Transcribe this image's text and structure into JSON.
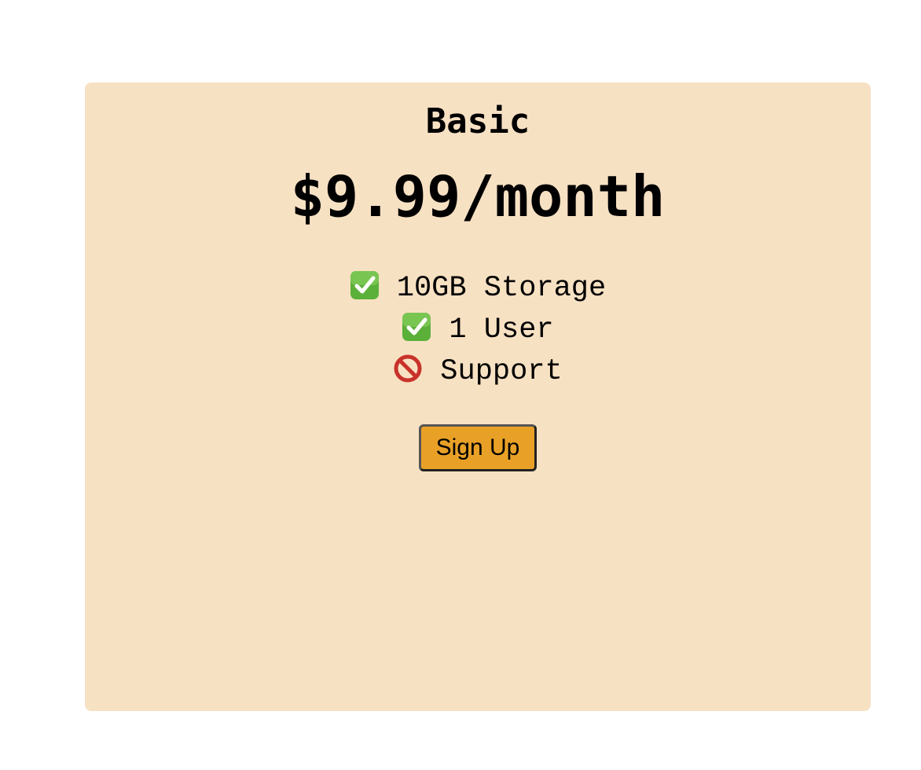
{
  "plan": {
    "name": "Basic",
    "price": "$9.99/month",
    "card_color": "#f7e1c3",
    "features": [
      {
        "icon": "check-icon",
        "text": "10GB Storage",
        "included": true
      },
      {
        "icon": "check-icon",
        "text": "1 User",
        "included": true
      },
      {
        "icon": "prohibited-icon",
        "text": "Support",
        "included": false
      }
    ],
    "cta": {
      "label": "Sign Up",
      "color": "#e8a126"
    }
  }
}
